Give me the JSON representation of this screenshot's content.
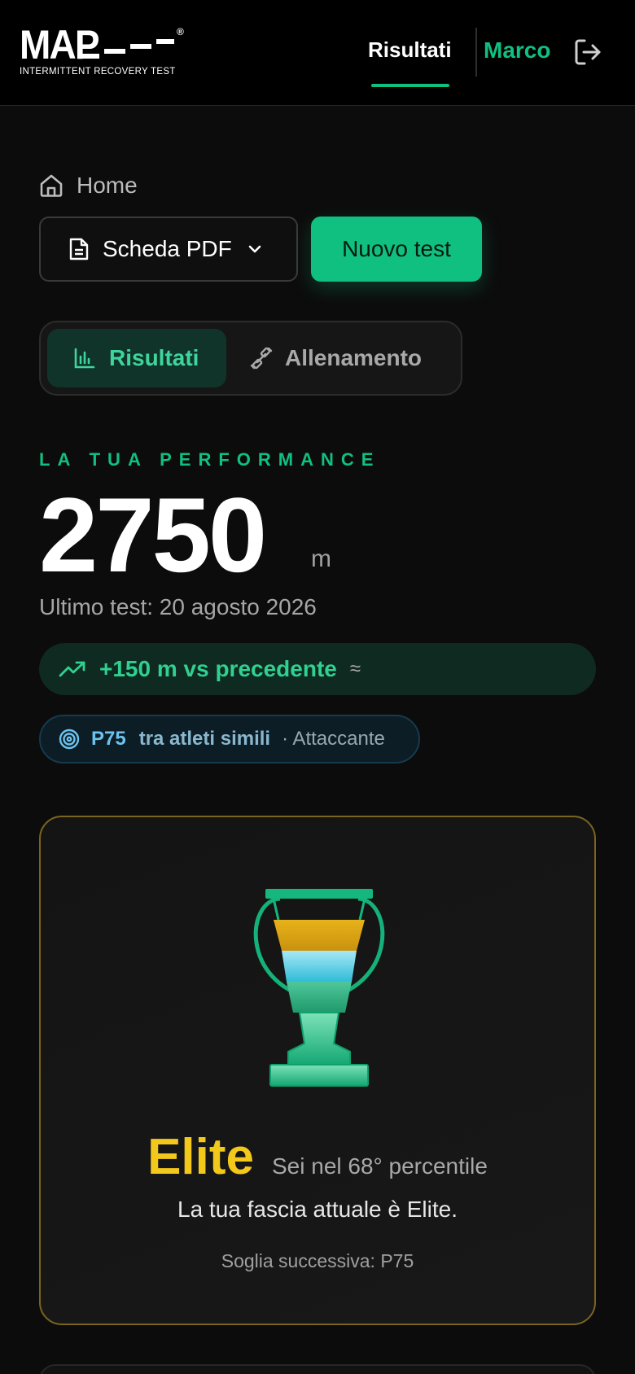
{
  "header": {
    "logo_text": "MAP",
    "logo_subtitle": "INTERMITTENT RECOVERY TEST",
    "logo_reg": "®",
    "nav_active": "Risultati",
    "user_name": "Marco",
    "accent_color": "#10c080"
  },
  "breadcrumb": {
    "home": "Home"
  },
  "actions": {
    "pdf_label": "Scheda PDF",
    "new_test_label": "Nuovo test"
  },
  "tabs": [
    {
      "label": "Risultati",
      "active": true,
      "icon": "bar-chart-icon"
    },
    {
      "label": "Allenamento",
      "active": false,
      "icon": "dumbbell-icon"
    }
  ],
  "performance": {
    "label": "LA TUA PERFORMANCE",
    "value": "2750",
    "unit": "m",
    "last_test": "Ultimo test: 20 agosto 2026",
    "delta": "+150 m vs precedente",
    "delta_approx": "≈",
    "percentile": "P75",
    "percentile_text": "tra atleti simili",
    "role": "· Attaccante"
  },
  "tier_card": {
    "tier": "Elite",
    "tier_color": "#f2c81a",
    "percentile_text": "Sei nel 68° percentile",
    "description": "La tua fascia attuale è Elite.",
    "next_threshold": "Soglia successiva: P75"
  }
}
